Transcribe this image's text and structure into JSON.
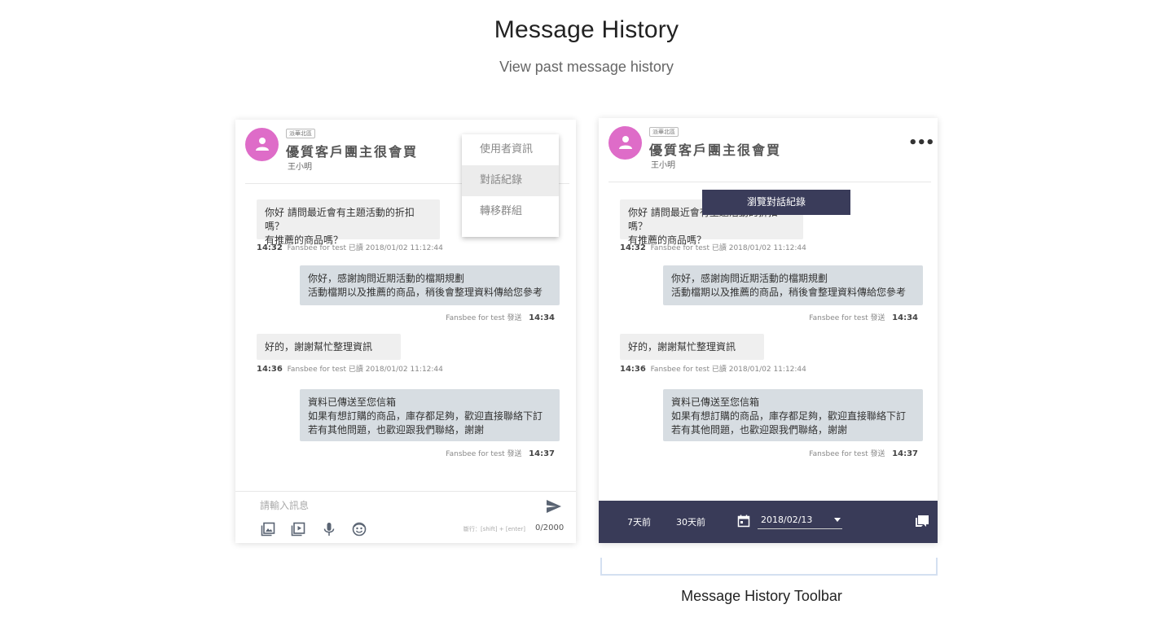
{
  "header": {
    "title": "Message History",
    "subtitle": "View past message history"
  },
  "chat": {
    "tag": "派華北區",
    "group_name": "優質客戶團主很會買",
    "user_name": "王小明",
    "messages": [
      {
        "text": "你好 請問最近會有主題活動的折扣嗎？\n有推薦的商品嗎？",
        "time": "14:32",
        "info": "Fansbee for test 已讀 2018/01/02 11:12:44"
      },
      {
        "text": "你好，感謝詢問近期活動的檔期規劃\n活動檔期以及推薦的商品，稍後會整理資料傳給您參考",
        "time": "14:34",
        "info": "Fansbee for test 發送"
      },
      {
        "text": "好的，謝謝幫忙整理資訊",
        "time": "14:36",
        "info": "Fansbee for test 已讀 2018/01/02 11:12:44"
      },
      {
        "text": "資料已傳送至您信箱\n如果有想訂購的商品，庫存都足夠，歡迎直接聯絡下訂\n若有其他問題，也歡迎跟我們聯絡，謝謝",
        "time": "14:37",
        "info": "Fansbee for test 發送"
      }
    ]
  },
  "menu": {
    "items": [
      "使用者資訊",
      "對話紀錄",
      "轉移群組"
    ],
    "active_index": 1
  },
  "composer": {
    "placeholder": "請輸入訊息",
    "hint": "斷行：[shift] + [enter]",
    "count": "0/2000",
    "tools": [
      "image-icon",
      "video-icon",
      "mic-icon",
      "emoji-icon"
    ]
  },
  "right_panel": {
    "more_label": "•••",
    "tooltip": "瀏覽對話紀錄"
  },
  "toolbar": {
    "btn_7days": "7天前",
    "btn_30days": "30天前",
    "date": "2018/02/13",
    "caption": "Message History Toolbar"
  },
  "colors": {
    "avatar": "#de6cc8",
    "toolbar": "#393b58",
    "bubble_out": "#d7dde2",
    "bubble_in": "#efefef"
  }
}
